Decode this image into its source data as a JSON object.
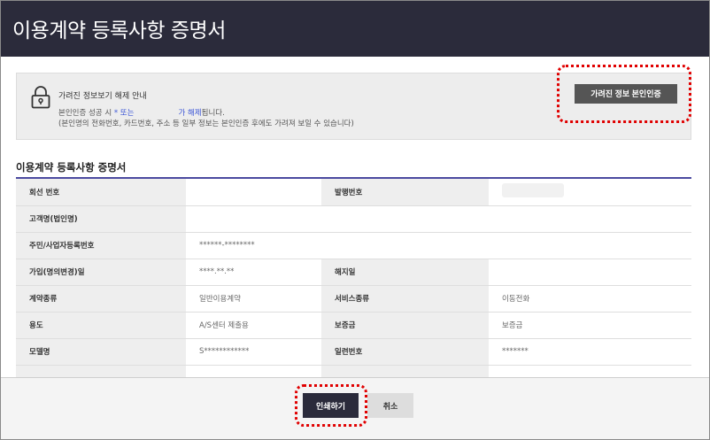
{
  "header": {
    "title": "이용계약 등록사항 증명서"
  },
  "notice": {
    "heading": "가려진 정보보기 해제 안내",
    "line1_prefix": "본인인증 성공 시",
    "line1_marker": "* 또는",
    "line1_highlight": "가 해제",
    "line1_suffix": "됩니다.",
    "line2": "(본인명의 전화번호, 카드번호, 주소 등 일부 정보는 본인인증 후에도 가려져 보일 수 있습니다)",
    "verify_button": "가려진 정보 본인인증"
  },
  "section": {
    "title": "이용계약 등록사항 증명서"
  },
  "table": {
    "rows": [
      {
        "l1": "회선 번호",
        "v1": "",
        "l2": "발행번호",
        "v2": ""
      },
      {
        "l1": "고객명(법인명)",
        "v1": ""
      },
      {
        "l1": "주민/사업자등록번호",
        "v1": "******-********"
      },
      {
        "l1": "가입(명의변경)일",
        "v1": "****.**.**",
        "l2": "해지일",
        "v2": ""
      },
      {
        "l1": "계약종류",
        "v1": "일반이용계약",
        "l2": "서비스종류",
        "v2": "이동전화"
      },
      {
        "l1": "용도",
        "v1": "A/S센터 제출용",
        "l2": "보증금",
        "v2": "보증금"
      },
      {
        "l1": "모델명",
        "v1": "S************",
        "l2": "일련번호",
        "v2": "*******"
      },
      {
        "l1": "",
        "v1": "",
        "l2": "",
        "v2": ""
      }
    ]
  },
  "footer": {
    "print_button": "인쇄하기",
    "cancel_button": "취소"
  },
  "colors": {
    "titlebar": "#2b2b3b",
    "accent_rule": "#4b4aa0",
    "highlight_dots": "#e00000"
  }
}
